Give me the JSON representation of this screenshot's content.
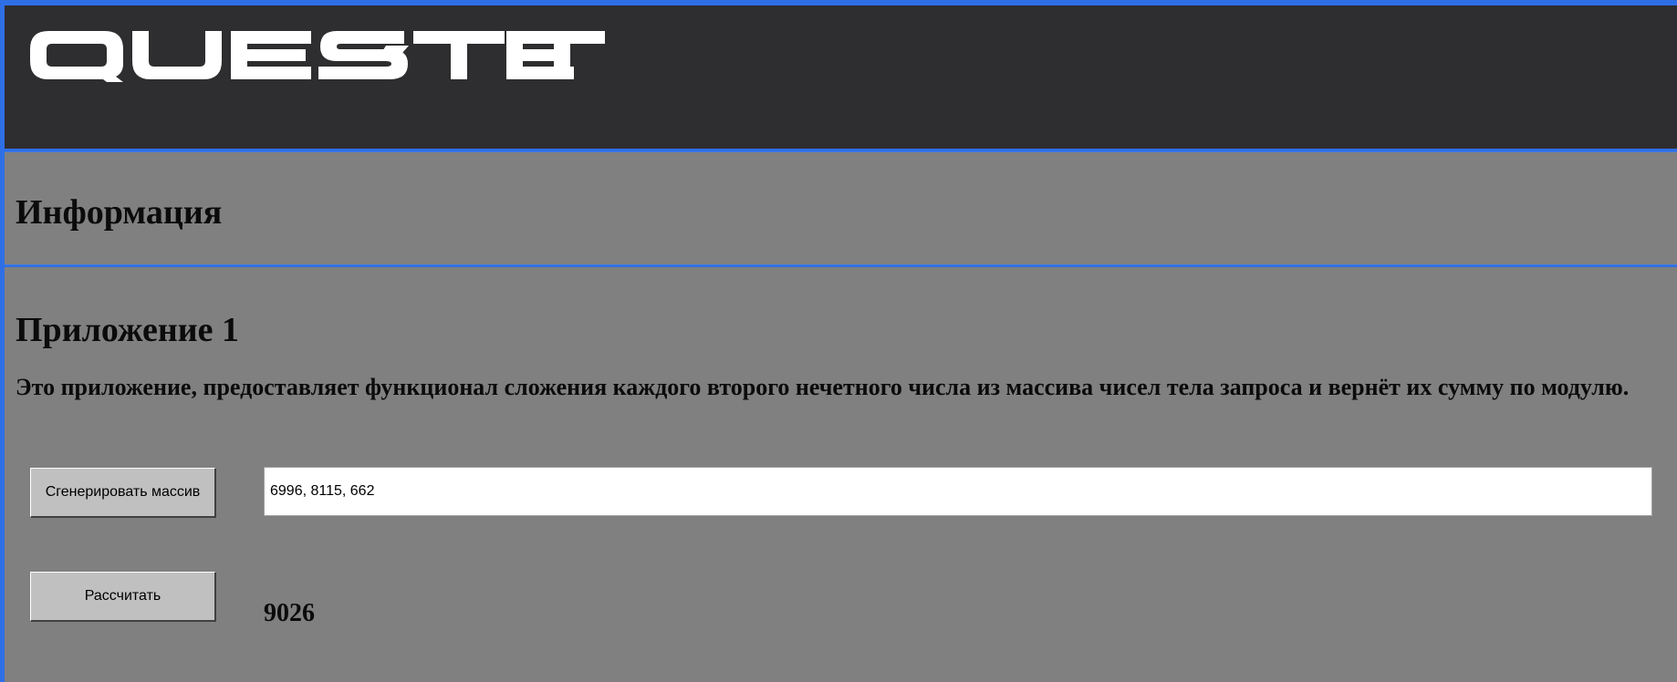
{
  "header": {
    "logo_text": "QUEST-TEST"
  },
  "info": {
    "title": "Информация"
  },
  "app": {
    "title": "Приложение 1",
    "description": "Это приложение, предоставляет функционал сложения каждого второго нечетного числа из массива чисел тела запроса и вернёт их сумму по модулю.",
    "generate_button": "Сгенерировать массив",
    "array_value": "6996, 8115, 662",
    "calculate_button": "Рассчитать",
    "result": "9026"
  },
  "colors": {
    "header_bg": "#2e2d2f",
    "content_bg": "#808080",
    "accent_border": "#2f6fe6",
    "button_bg": "#c0c0c0"
  }
}
